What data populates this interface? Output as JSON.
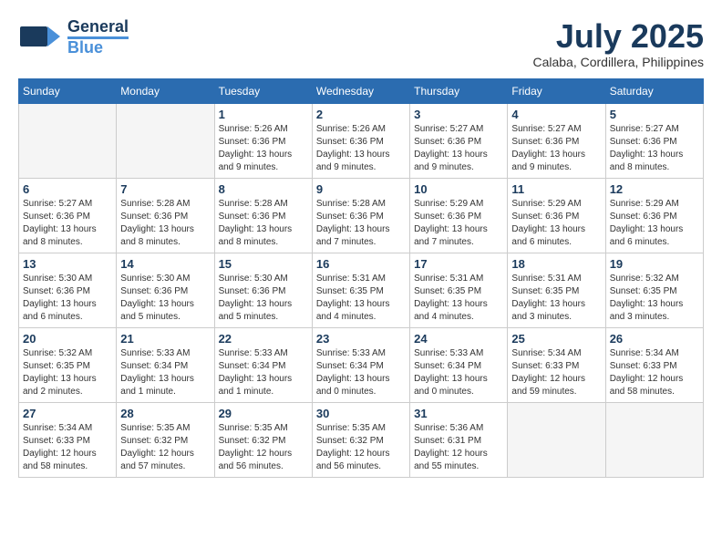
{
  "logo": {
    "general": "General",
    "blue": "Blue"
  },
  "header": {
    "month_year": "July 2025",
    "location": "Calaba, Cordillera, Philippines"
  },
  "weekdays": [
    "Sunday",
    "Monday",
    "Tuesday",
    "Wednesday",
    "Thursday",
    "Friday",
    "Saturday"
  ],
  "weeks": [
    [
      {
        "day": "",
        "info": ""
      },
      {
        "day": "",
        "info": ""
      },
      {
        "day": "1",
        "info": "Sunrise: 5:26 AM\nSunset: 6:36 PM\nDaylight: 13 hours\nand 9 minutes."
      },
      {
        "day": "2",
        "info": "Sunrise: 5:26 AM\nSunset: 6:36 PM\nDaylight: 13 hours\nand 9 minutes."
      },
      {
        "day": "3",
        "info": "Sunrise: 5:27 AM\nSunset: 6:36 PM\nDaylight: 13 hours\nand 9 minutes."
      },
      {
        "day": "4",
        "info": "Sunrise: 5:27 AM\nSunset: 6:36 PM\nDaylight: 13 hours\nand 9 minutes."
      },
      {
        "day": "5",
        "info": "Sunrise: 5:27 AM\nSunset: 6:36 PM\nDaylight: 13 hours\nand 8 minutes."
      }
    ],
    [
      {
        "day": "6",
        "info": "Sunrise: 5:27 AM\nSunset: 6:36 PM\nDaylight: 13 hours\nand 8 minutes."
      },
      {
        "day": "7",
        "info": "Sunrise: 5:28 AM\nSunset: 6:36 PM\nDaylight: 13 hours\nand 8 minutes."
      },
      {
        "day": "8",
        "info": "Sunrise: 5:28 AM\nSunset: 6:36 PM\nDaylight: 13 hours\nand 8 minutes."
      },
      {
        "day": "9",
        "info": "Sunrise: 5:28 AM\nSunset: 6:36 PM\nDaylight: 13 hours\nand 7 minutes."
      },
      {
        "day": "10",
        "info": "Sunrise: 5:29 AM\nSunset: 6:36 PM\nDaylight: 13 hours\nand 7 minutes."
      },
      {
        "day": "11",
        "info": "Sunrise: 5:29 AM\nSunset: 6:36 PM\nDaylight: 13 hours\nand 6 minutes."
      },
      {
        "day": "12",
        "info": "Sunrise: 5:29 AM\nSunset: 6:36 PM\nDaylight: 13 hours\nand 6 minutes."
      }
    ],
    [
      {
        "day": "13",
        "info": "Sunrise: 5:30 AM\nSunset: 6:36 PM\nDaylight: 13 hours\nand 6 minutes."
      },
      {
        "day": "14",
        "info": "Sunrise: 5:30 AM\nSunset: 6:36 PM\nDaylight: 13 hours\nand 5 minutes."
      },
      {
        "day": "15",
        "info": "Sunrise: 5:30 AM\nSunset: 6:36 PM\nDaylight: 13 hours\nand 5 minutes."
      },
      {
        "day": "16",
        "info": "Sunrise: 5:31 AM\nSunset: 6:35 PM\nDaylight: 13 hours\nand 4 minutes."
      },
      {
        "day": "17",
        "info": "Sunrise: 5:31 AM\nSunset: 6:35 PM\nDaylight: 13 hours\nand 4 minutes."
      },
      {
        "day": "18",
        "info": "Sunrise: 5:31 AM\nSunset: 6:35 PM\nDaylight: 13 hours\nand 3 minutes."
      },
      {
        "day": "19",
        "info": "Sunrise: 5:32 AM\nSunset: 6:35 PM\nDaylight: 13 hours\nand 3 minutes."
      }
    ],
    [
      {
        "day": "20",
        "info": "Sunrise: 5:32 AM\nSunset: 6:35 PM\nDaylight: 13 hours\nand 2 minutes."
      },
      {
        "day": "21",
        "info": "Sunrise: 5:33 AM\nSunset: 6:34 PM\nDaylight: 13 hours\nand 1 minute."
      },
      {
        "day": "22",
        "info": "Sunrise: 5:33 AM\nSunset: 6:34 PM\nDaylight: 13 hours\nand 1 minute."
      },
      {
        "day": "23",
        "info": "Sunrise: 5:33 AM\nSunset: 6:34 PM\nDaylight: 13 hours\nand 0 minutes."
      },
      {
        "day": "24",
        "info": "Sunrise: 5:33 AM\nSunset: 6:34 PM\nDaylight: 13 hours\nand 0 minutes."
      },
      {
        "day": "25",
        "info": "Sunrise: 5:34 AM\nSunset: 6:33 PM\nDaylight: 12 hours\nand 59 minutes."
      },
      {
        "day": "26",
        "info": "Sunrise: 5:34 AM\nSunset: 6:33 PM\nDaylight: 12 hours\nand 58 minutes."
      }
    ],
    [
      {
        "day": "27",
        "info": "Sunrise: 5:34 AM\nSunset: 6:33 PM\nDaylight: 12 hours\nand 58 minutes."
      },
      {
        "day": "28",
        "info": "Sunrise: 5:35 AM\nSunset: 6:32 PM\nDaylight: 12 hours\nand 57 minutes."
      },
      {
        "day": "29",
        "info": "Sunrise: 5:35 AM\nSunset: 6:32 PM\nDaylight: 12 hours\nand 56 minutes."
      },
      {
        "day": "30",
        "info": "Sunrise: 5:35 AM\nSunset: 6:32 PM\nDaylight: 12 hours\nand 56 minutes."
      },
      {
        "day": "31",
        "info": "Sunrise: 5:36 AM\nSunset: 6:31 PM\nDaylight: 12 hours\nand 55 minutes."
      },
      {
        "day": "",
        "info": ""
      },
      {
        "day": "",
        "info": ""
      }
    ]
  ]
}
